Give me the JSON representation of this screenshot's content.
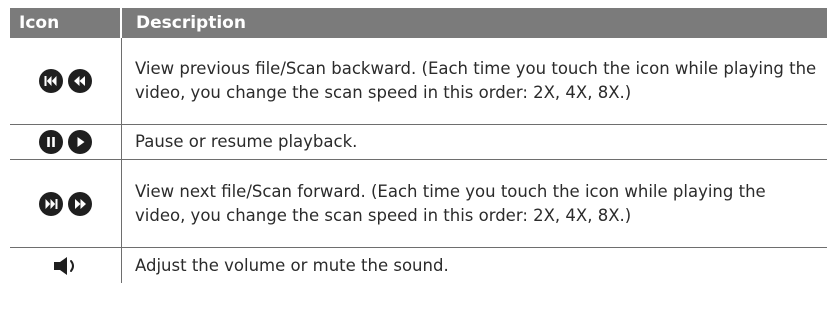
{
  "header": {
    "icon_label": "Icon",
    "description_label": "Description"
  },
  "rows": [
    {
      "icons": [
        "skip-previous-icon",
        "rewind-icon"
      ],
      "text": "View previous file/Scan backward. (Each time you touch the icon while playing the video, you change the scan speed in this order: 2X, 4X, 8X.)"
    },
    {
      "icons": [
        "pause-icon",
        "play-icon"
      ],
      "text": "Pause or resume playback."
    },
    {
      "icons": [
        "skip-next-icon",
        "fast-forward-icon"
      ],
      "text": "View next file/Scan forward. (Each time you touch the icon while playing the video, you change the scan speed in this order: 2X, 4X, 8X.)"
    },
    {
      "icons": [
        "volume-icon"
      ],
      "text": "Adjust the volume or mute the sound."
    }
  ],
  "colors": {
    "header_bg": "#7b7b7b",
    "header_text": "#ffffff",
    "icon_fill": "#1f1f1f",
    "border": "#6e6e6e"
  }
}
